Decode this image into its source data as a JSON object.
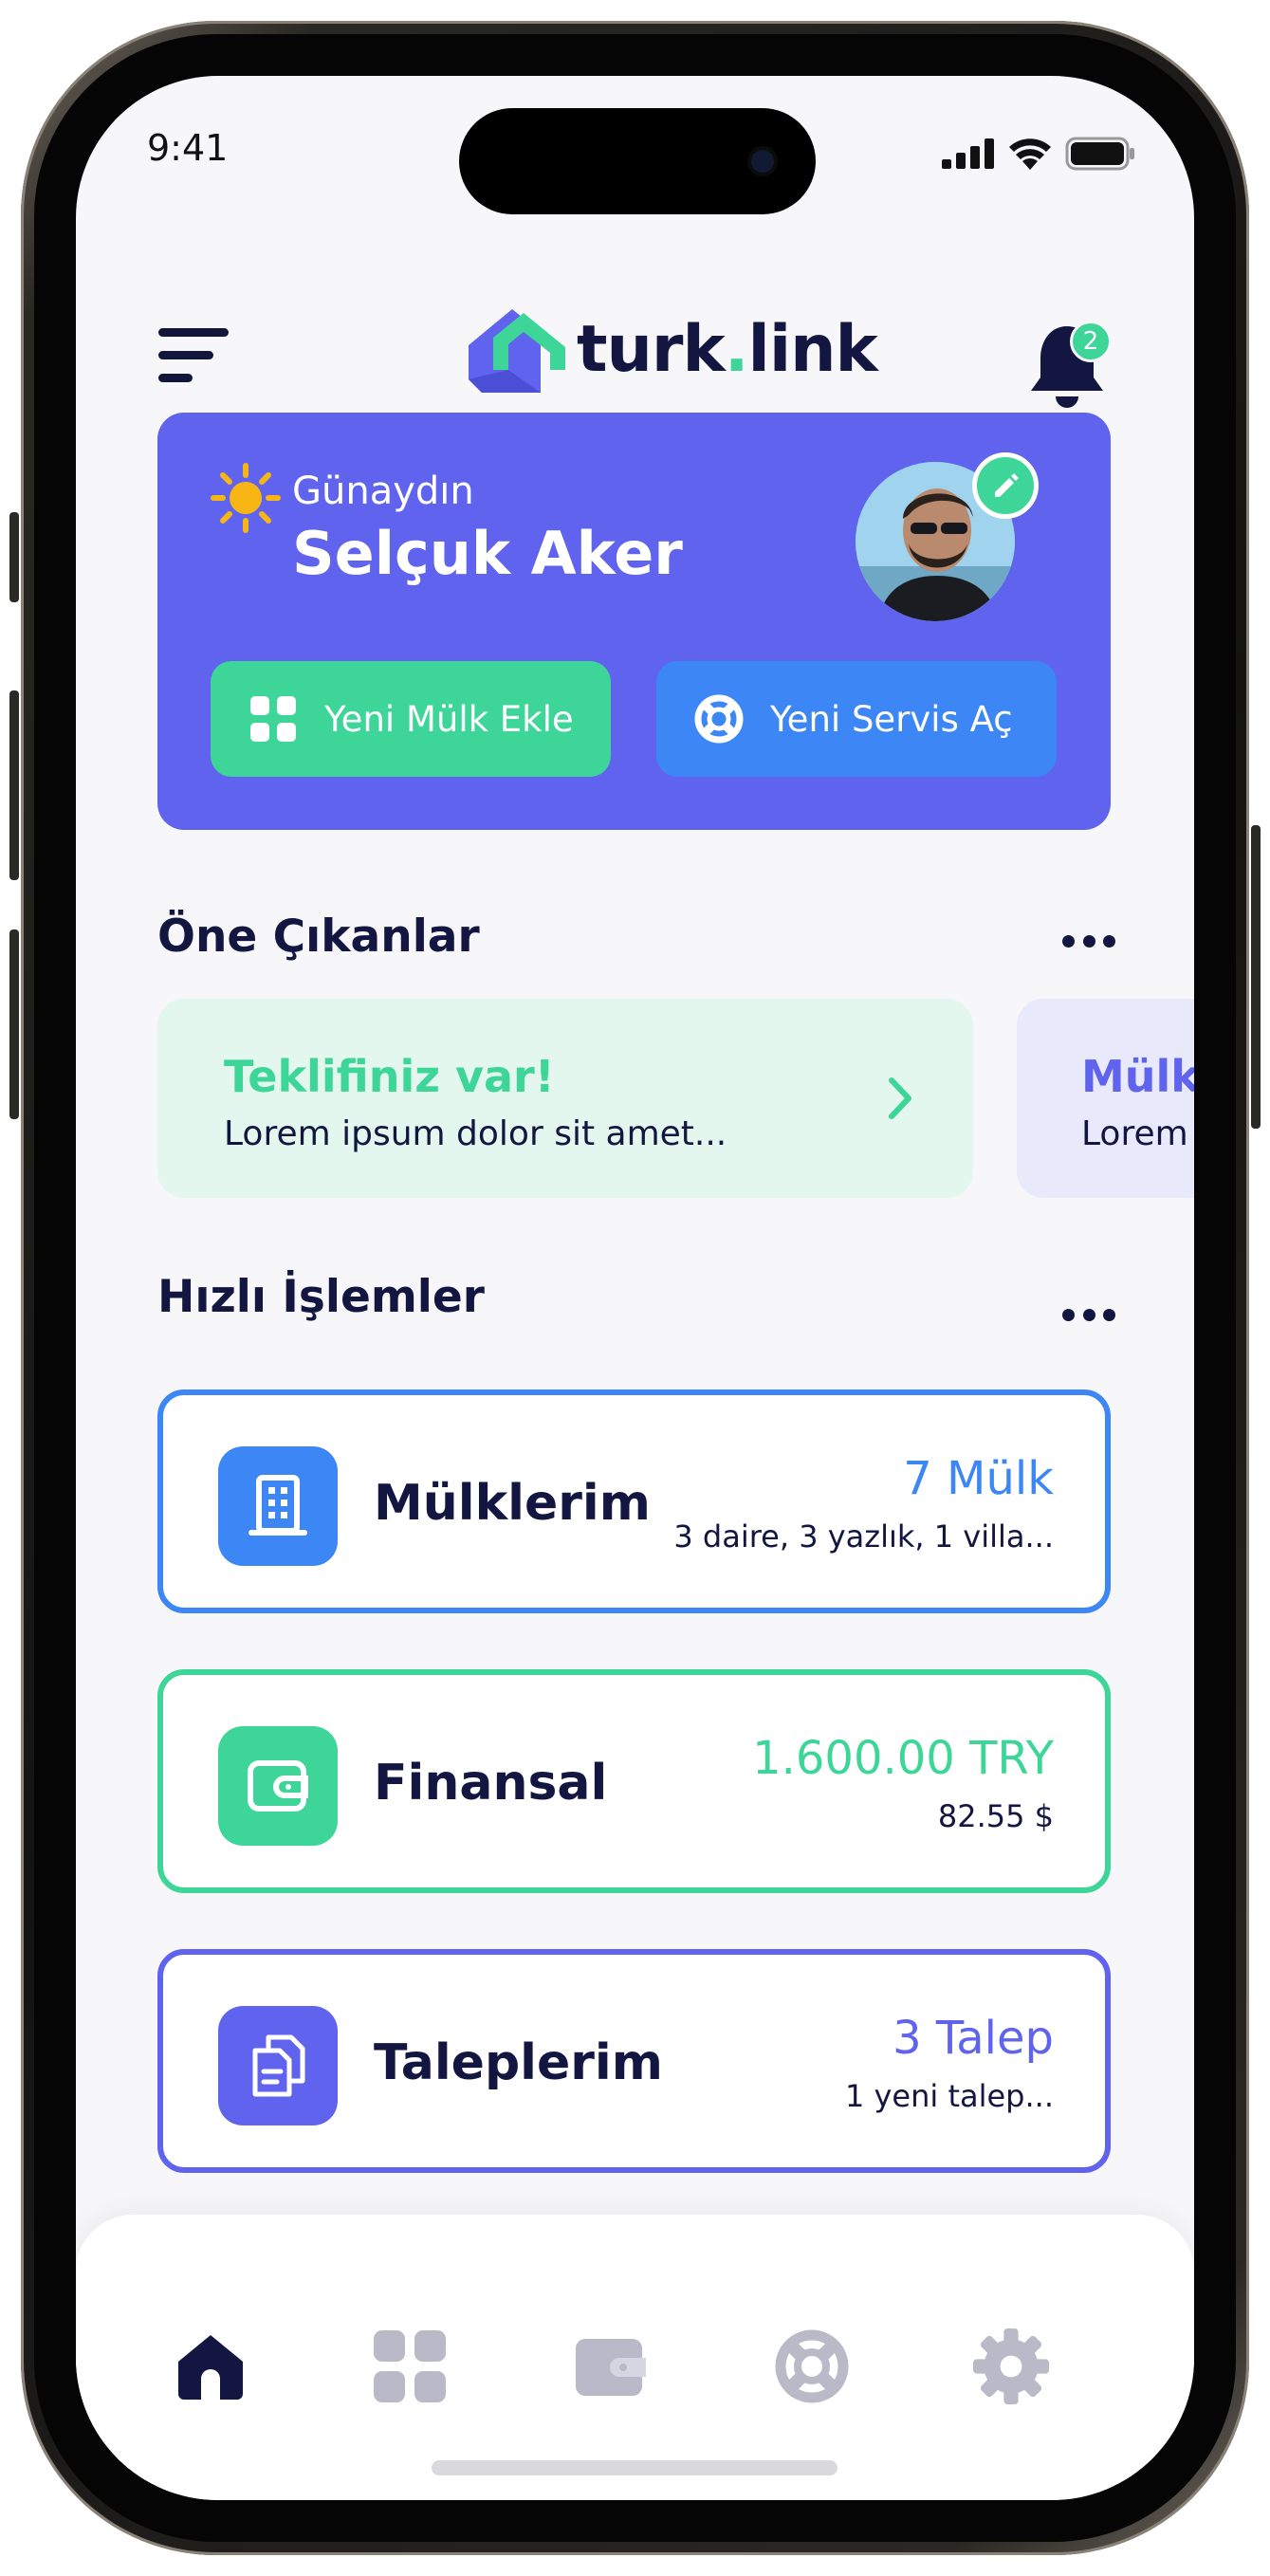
{
  "status_bar": {
    "time": "9:41"
  },
  "header": {
    "logo_text_main": "turk",
    "logo_text_dot": ".",
    "logo_text_end": "link",
    "notification_count": "2"
  },
  "hero": {
    "greeting": "Günaydın",
    "user_name": "Selçuk Aker",
    "primary_button": "Yeni Mülk Ekle",
    "secondary_button": "Yeni Servis Aç"
  },
  "featured": {
    "title": "Öne Çıkanlar",
    "cards": [
      {
        "title": "Teklifiniz var!",
        "subtitle": "Lorem ipsum dolor sit amet..."
      },
      {
        "title": "Mülk",
        "subtitle": "Lorem"
      }
    ]
  },
  "quick_actions": {
    "title": "Hızlı İşlemler",
    "items": [
      {
        "label": "Mülklerim",
        "value": "7 Mülk",
        "sub": "3 daire, 3 yazlık, 1 villa..."
      },
      {
        "label": "Finansal",
        "value": "1.600.00 TRY",
        "sub": "82.55 $"
      },
      {
        "label": "Taleplerim",
        "value": "3 Talep",
        "sub": "1 yeni talep..."
      }
    ]
  },
  "tab_bar": {
    "tabs": [
      "home-icon",
      "grid-icon",
      "wallet-icon",
      "lifebuoy-icon",
      "gear-icon"
    ],
    "active": "home-icon"
  },
  "colors": {
    "brand_navy": "#121640",
    "purple": "#6063ee",
    "green": "#3dd598",
    "blue": "#3c86f5",
    "inactive_icon": "#b9b9c8"
  }
}
